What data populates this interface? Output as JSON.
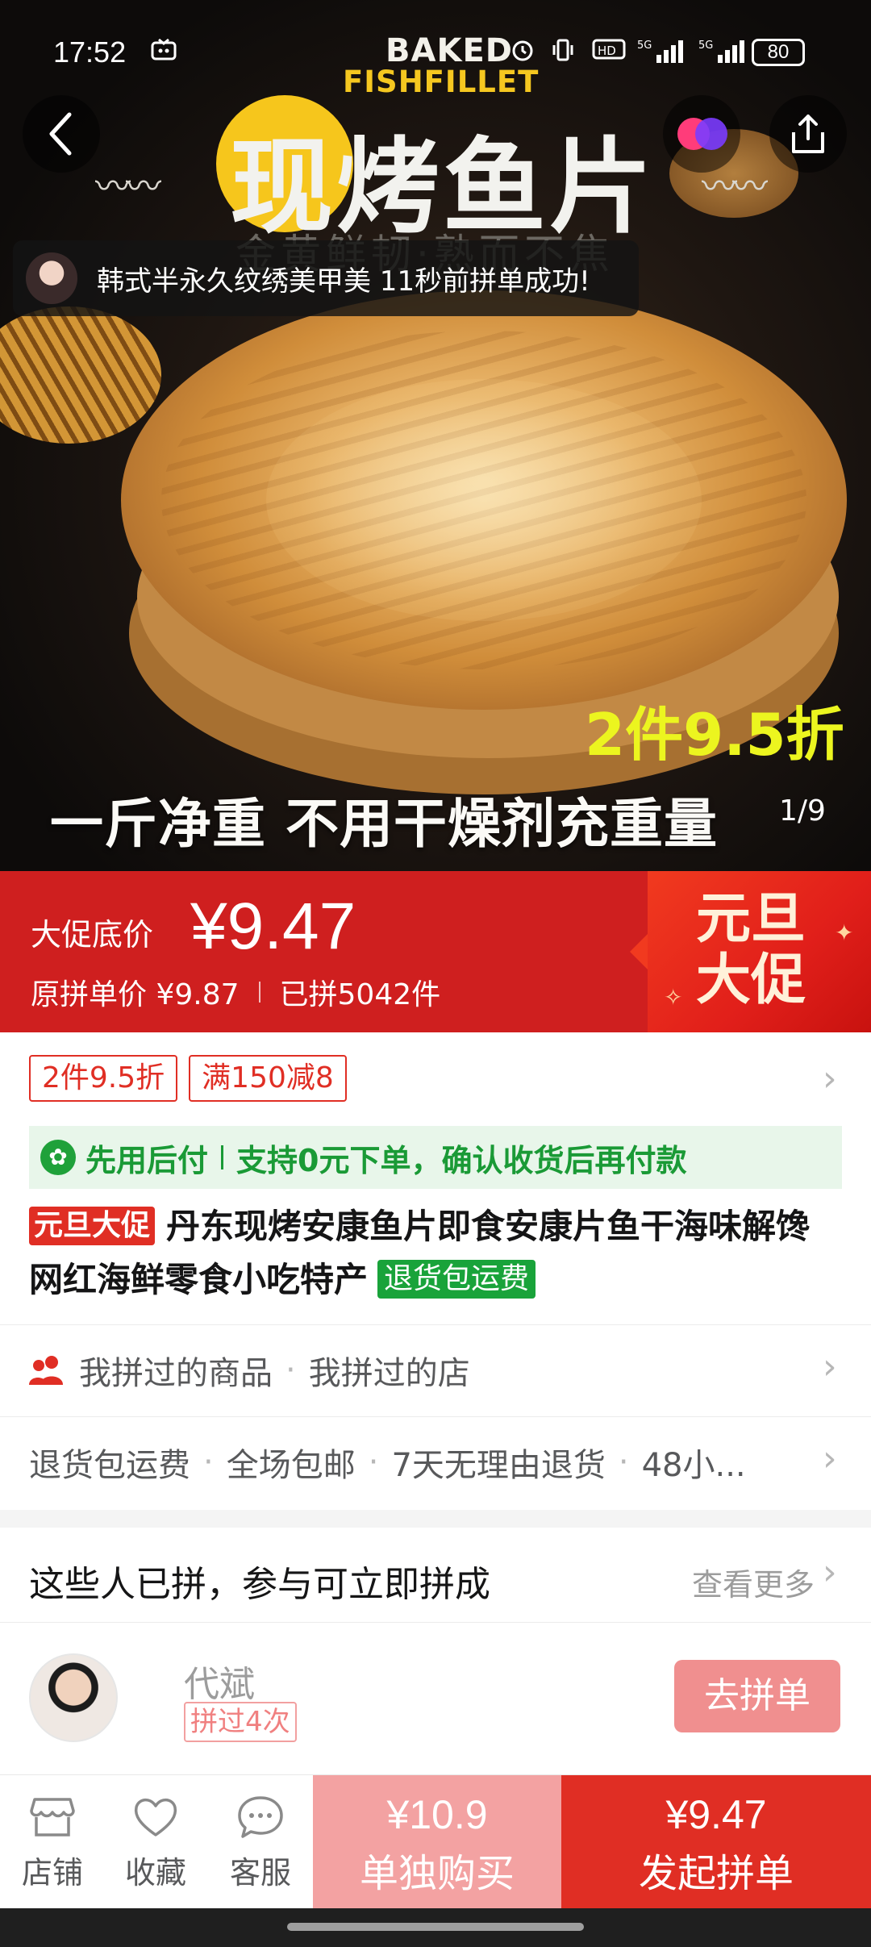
{
  "status_bar": {
    "time": "17:52",
    "battery": "80",
    "icons": [
      "media-icon",
      "alarm-icon",
      "vibrate-icon",
      "hd-icon",
      "signal-5g-icon",
      "signal-5g-icon"
    ]
  },
  "hero": {
    "brand_top": "BAKED",
    "brand_sub": "FISHFILLET",
    "title": "现烤鱼片",
    "tagline": "金黄鲜韧·熟而不焦",
    "promo": "2件9.5折",
    "bottom_text": "一斤净重 不用干燥剂充重量",
    "image_counter": "1/9"
  },
  "toast": {
    "text": "韩式半永久纹绣美甲美 11秒前拼单成功!"
  },
  "price": {
    "promo_label": "大促底价",
    "promo_price": "¥9.47",
    "original": "原拼单价 ¥9.87",
    "sold": "已拼5042件",
    "festival_line1": "元旦",
    "festival_line2": "大促"
  },
  "coupons": [
    "2件9.5折",
    "满150减8"
  ],
  "pay_after": {
    "label": "先用后付",
    "desc": "支持0元下单，确认收货后再付款"
  },
  "product": {
    "festival_tag": "元旦大促",
    "title": "丹东现烤安康鱼片即食安康片鱼干海味解馋网红海鲜零食小吃特产",
    "return_tag": "退货包运费"
  },
  "history": {
    "item1": "我拼过的商品",
    "sep": "·",
    "item2": "我拼过的店"
  },
  "services": {
    "items": [
      "退货包运费",
      "全场包邮",
      "7天无理由退货",
      "48小..."
    ]
  },
  "group": {
    "title": "这些人已拼，参与可立即拼成",
    "more": "查看更多",
    "member_name": "代斌",
    "member_count": "拼过4次",
    "join_label": "去拼单"
  },
  "bottom_bar": {
    "store": "店铺",
    "favorite": "收藏",
    "service": "客服",
    "alone_price": "¥10.9",
    "alone_label": "单独购买",
    "group_price": "¥9.47",
    "group_label": "发起拼单"
  },
  "colors": {
    "brand_red": "#e02e24",
    "light_red": "#f3a2a2",
    "green": "#19a33a",
    "promo_yellow": "#ecf51f"
  }
}
